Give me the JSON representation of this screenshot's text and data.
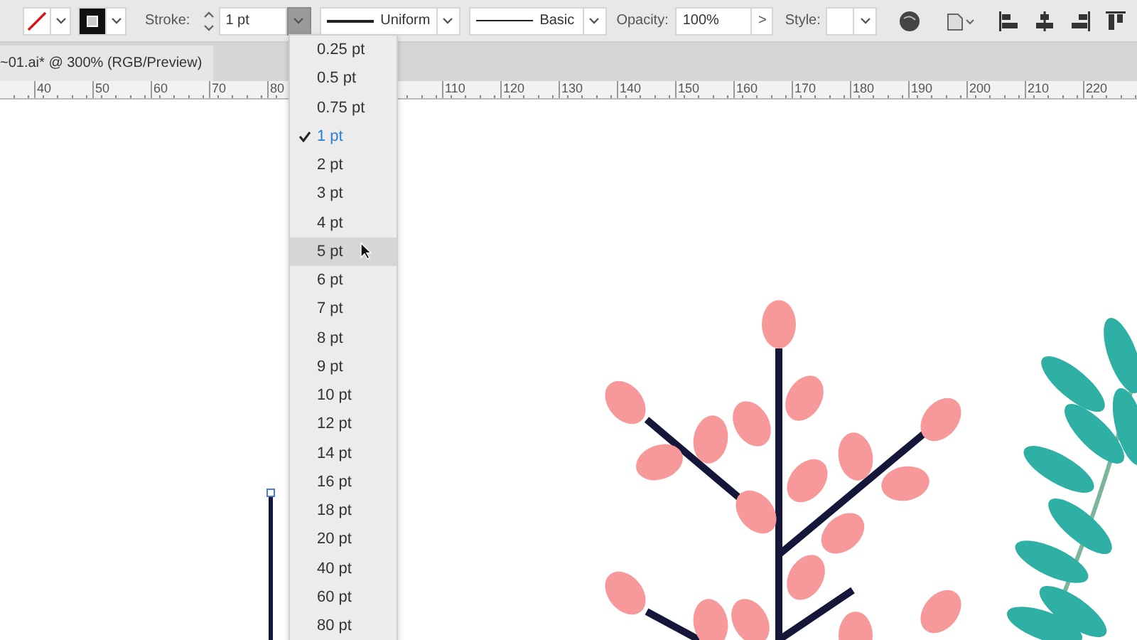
{
  "toolbar": {
    "stroke_label": "Stroke:",
    "stroke_weight": "1 pt",
    "stroke_profile": "Uniform",
    "brush": "Basic",
    "opacity_label": "Opacity:",
    "opacity": "100%",
    "opacity_arrow": ">",
    "style_label": "Style:"
  },
  "document_tab": {
    "title": "~01.ai* @ 300% (RGB/Preview)"
  },
  "ruler": {
    "left_labels": [
      "40",
      "50",
      "60",
      "70",
      "80"
    ],
    "right_labels": [
      "110",
      "120",
      "130",
      "140",
      "150",
      "160",
      "170",
      "180",
      "190",
      "200",
      "210",
      "220"
    ]
  },
  "stroke_weight_menu": {
    "items": [
      {
        "label": "0.25 pt",
        "selected": false,
        "highlighted": false
      },
      {
        "label": "0.5 pt",
        "selected": false,
        "highlighted": false
      },
      {
        "label": "0.75 pt",
        "selected": false,
        "highlighted": false
      },
      {
        "label": "1 pt",
        "selected": true,
        "highlighted": false
      },
      {
        "label": "2 pt",
        "selected": false,
        "highlighted": false
      },
      {
        "label": "3 pt",
        "selected": false,
        "highlighted": false
      },
      {
        "label": "4 pt",
        "selected": false,
        "highlighted": false
      },
      {
        "label": "5 pt",
        "selected": false,
        "highlighted": true
      },
      {
        "label": "6 pt",
        "selected": false,
        "highlighted": false
      },
      {
        "label": "7 pt",
        "selected": false,
        "highlighted": false
      },
      {
        "label": "8 pt",
        "selected": false,
        "highlighted": false
      },
      {
        "label": "9 pt",
        "selected": false,
        "highlighted": false
      },
      {
        "label": "10 pt",
        "selected": false,
        "highlighted": false
      },
      {
        "label": "12 pt",
        "selected": false,
        "highlighted": false
      },
      {
        "label": "14 pt",
        "selected": false,
        "highlighted": false
      },
      {
        "label": "16 pt",
        "selected": false,
        "highlighted": false
      },
      {
        "label": "18 pt",
        "selected": false,
        "highlighted": false
      },
      {
        "label": "20 pt",
        "selected": false,
        "highlighted": false
      },
      {
        "label": "40 pt",
        "selected": false,
        "highlighted": false
      },
      {
        "label": "60 pt",
        "selected": false,
        "highlighted": false
      },
      {
        "label": "80 pt",
        "selected": false,
        "highlighted": false
      }
    ]
  }
}
